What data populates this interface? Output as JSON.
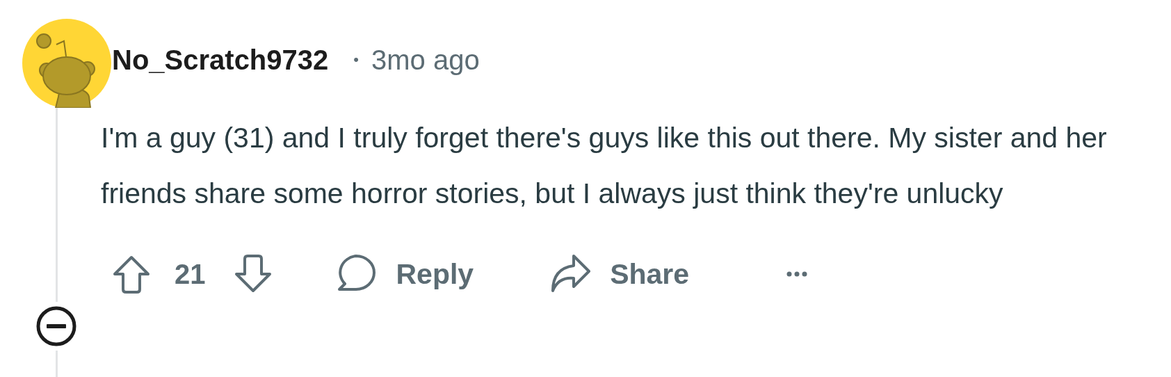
{
  "comment": {
    "author": "No_Scratch9732",
    "separator": "•",
    "time": "3mo ago",
    "body": "I'm a guy (31) and I truly forget there's guys like this out there. My sister and her friends share some horror stories, but I always just think they're unlucky",
    "collapsed": false,
    "votes": "21",
    "actions": [
      {
        "kind": "reply",
        "label": "Reply"
      },
      {
        "kind": "share",
        "label": "Share"
      }
    ]
  }
}
